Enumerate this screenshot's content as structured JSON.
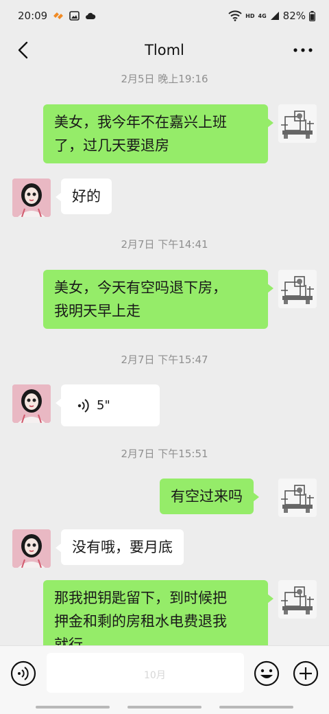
{
  "status_bar": {
    "time": "20:09",
    "network": "HD",
    "network_gen": "4G",
    "battery": "82%"
  },
  "header": {
    "title": "Tloml"
  },
  "timestamps": [
    "2月5日 晚上19:16",
    "2月7日 下午14:41",
    "2月7日 下午15:47",
    "2月7日 下午15:51"
  ],
  "messages": [
    {
      "from": "me",
      "text": "美女，我今年不在嘉兴上班\n了，过几天要退房"
    },
    {
      "from": "her",
      "text": "好的"
    },
    {
      "from": "me",
      "text": "美女，今天有空吗退下房，\n我明天早上走"
    },
    {
      "from": "her",
      "type": "voice",
      "duration": "5\""
    },
    {
      "from": "me",
      "text": "有空过来吗"
    },
    {
      "from": "her",
      "text": "没有哦，要月底"
    },
    {
      "from": "me",
      "text": "那我把钥匙留下，到时候把\n押金和剩的房租水电费退我\n就行"
    }
  ],
  "input": {
    "value": "",
    "watermark": "10月"
  },
  "colors": {
    "background": "#ededed",
    "sent_bubble": "#95ec69",
    "received_bubble": "#ffffff",
    "timestamp": "#8f8f8f"
  },
  "icons": {
    "back": "chevron-left-icon",
    "more": "more-dots-icon",
    "voice_input": "voice-input-icon",
    "emoji": "emoji-icon",
    "plus": "plus-icon"
  }
}
